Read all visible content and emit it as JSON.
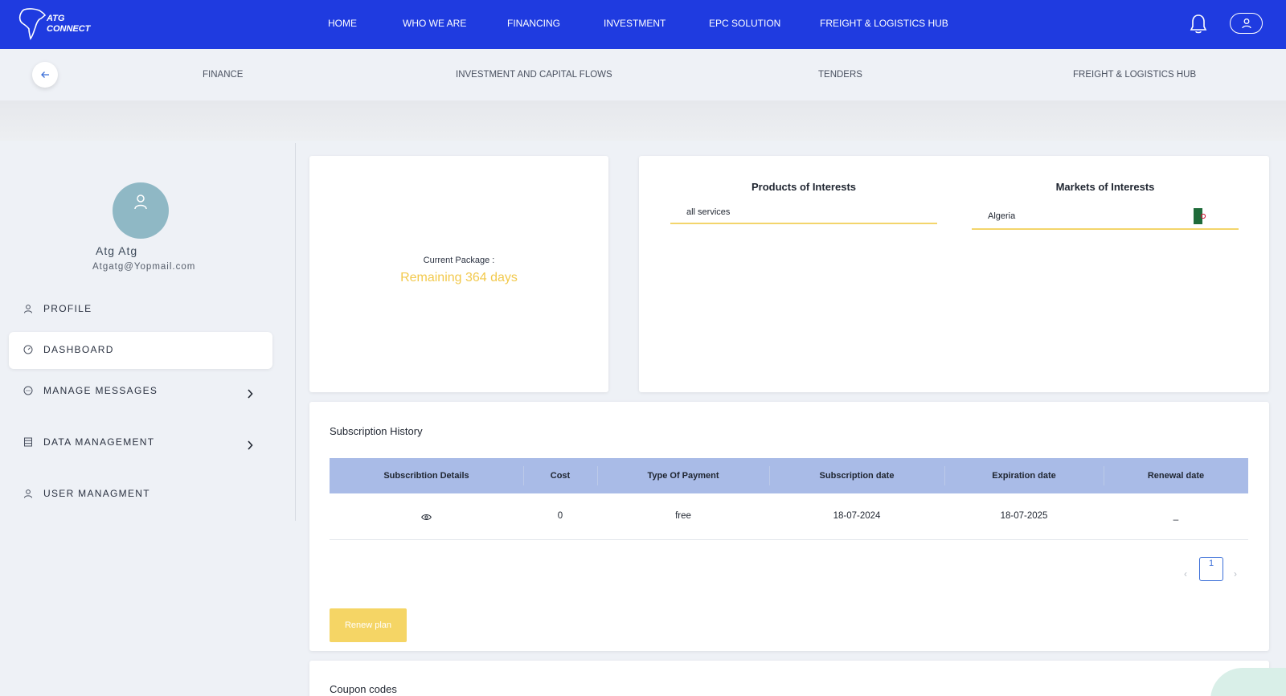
{
  "brand": {
    "line1": "ATG",
    "line2": "CONNECT"
  },
  "nav": {
    "items": [
      "HOME",
      "WHO WE ARE",
      "FINANCING",
      "INVESTMENT",
      "EPC SOLUTION",
      "FREIGHT & LOGISTICS HUB"
    ]
  },
  "subnav": {
    "items": [
      "FINANCE",
      "INVESTMENT AND CAPITAL FLOWS",
      "TENDERS",
      "FREIGHT & LOGISTICS HUB"
    ]
  },
  "user": {
    "name": "Atg Atg",
    "email": "Atgatg@Yopmail.com"
  },
  "sidebar": {
    "items": [
      {
        "label": "PROFILE",
        "icon": "user-icon"
      },
      {
        "label": "DASHBOARD",
        "icon": "dashboard-icon"
      },
      {
        "label": "MANAGE MESSAGES",
        "icon": "message-icon"
      },
      {
        "label": "DATA MANAGEMENT",
        "icon": "database-icon"
      },
      {
        "label": "USER MANAGMENT",
        "icon": "user-icon"
      }
    ]
  },
  "package": {
    "label": "Current Package :",
    "remaining": "Remaining 364 days"
  },
  "interests": {
    "products_title": "Products of Interests",
    "products_value": "all services",
    "markets_title": "Markets of Interests",
    "markets_value": "Algeria"
  },
  "subscription": {
    "title": "Subscription History",
    "columns": [
      "Subscribtion Details",
      "Cost",
      "Type Of Payment",
      "Subscription date",
      "Expiration date",
      "Renewal date"
    ],
    "rows": [
      {
        "cost": "0",
        "type": "free",
        "subscription_date": "18-07-2024",
        "expiration_date": "18-07-2025",
        "renewal_date": "_"
      }
    ],
    "page": "1",
    "renew_label": "Renew plan"
  },
  "coupons": {
    "title": "Coupon codes"
  },
  "colors": {
    "primary": "#1f3be0",
    "accent": "#f2c94c",
    "table_header": "#a9bbe7"
  }
}
